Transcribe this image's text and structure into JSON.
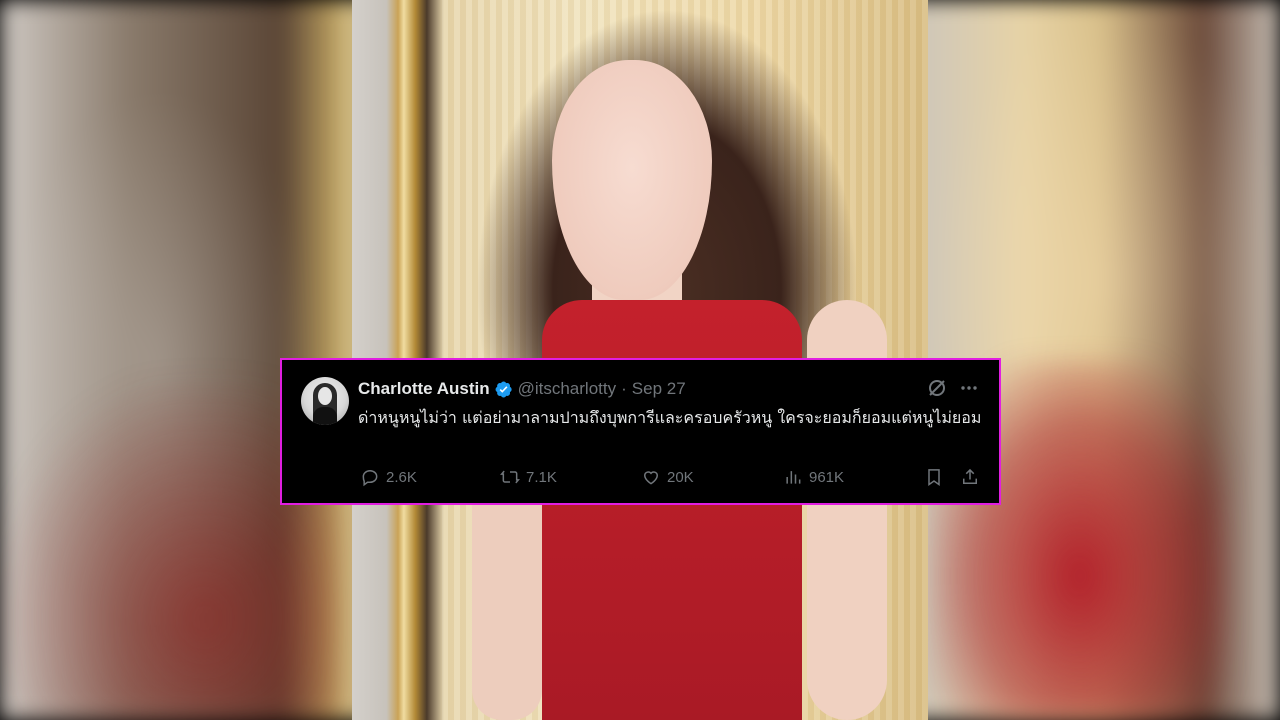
{
  "tweet": {
    "author": {
      "name": "Charlotte Austin",
      "handle": "@itscharlotty",
      "separator": "·",
      "date": "Sep 27",
      "verified_color": "#1d9bf0"
    },
    "text": "ด่าหนูหนูไม่ว่า แต่อย่ามาลามปามถึงบุพการีและครอบครัวหนู ใครจะยอมก็ยอมแต่หนูไม่ยอม",
    "stats": {
      "replies": "2.6K",
      "reposts": "7.1K",
      "likes": "20K",
      "views": "961K"
    },
    "icons": {
      "grok": "grok-icon",
      "more": "more-icon",
      "reply": "reply-icon",
      "repost": "repost-icon",
      "like": "heart-icon",
      "views": "views-icon",
      "bookmark": "bookmark-icon",
      "share": "share-icon"
    },
    "border_color": "#e11ee1"
  }
}
